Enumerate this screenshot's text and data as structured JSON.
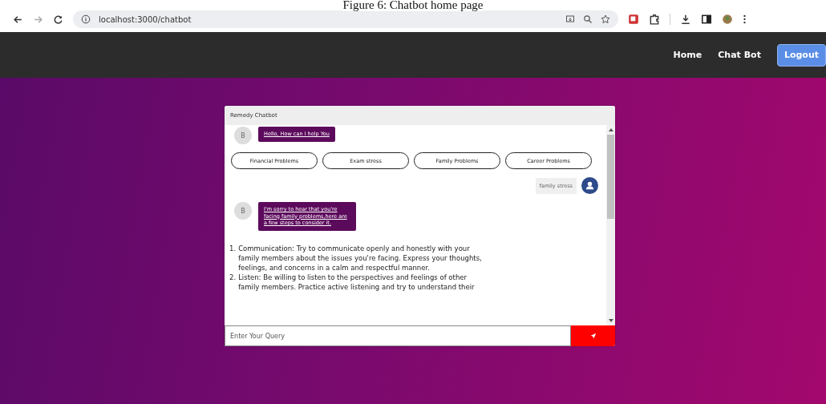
{
  "caption": "Figure 6: Chatbot home page",
  "browser": {
    "url": "localhost:3000/chatbot"
  },
  "nav": {
    "links": [
      {
        "label": "Home",
        "kind": "link"
      },
      {
        "label": "Chat Bot",
        "kind": "link"
      },
      {
        "label": "Logout",
        "kind": "button"
      }
    ]
  },
  "chat": {
    "title": "Remedy Chatbot",
    "messages": [
      {
        "kind": "bot",
        "avatar": "B",
        "text": "Hello, How can I help You"
      },
      {
        "kind": "options",
        "options": [
          "Financial Problems",
          "Exam stress",
          "Family Problems",
          "Career Problems"
        ]
      },
      {
        "kind": "user",
        "text": "family stress"
      },
      {
        "kind": "bot",
        "avatar": "B",
        "text": "I'm sorry to hear that you're facing family problems,here are a few steps to consider it."
      },
      {
        "kind": "list",
        "items": [
          {
            "number": "1.",
            "text": "Communication: Try to communicate openly and honestly with your family members about the issues you're facing. Express your thoughts, feelings, and concerns in a calm and respectful manner."
          },
          {
            "number": "2.",
            "text": "Listen: Be willing to listen to the perspectives and feelings of other family members. Practice active listening and try to understand their"
          }
        ]
      }
    ],
    "input": {
      "placeholder": "Enter Your Query"
    }
  }
}
